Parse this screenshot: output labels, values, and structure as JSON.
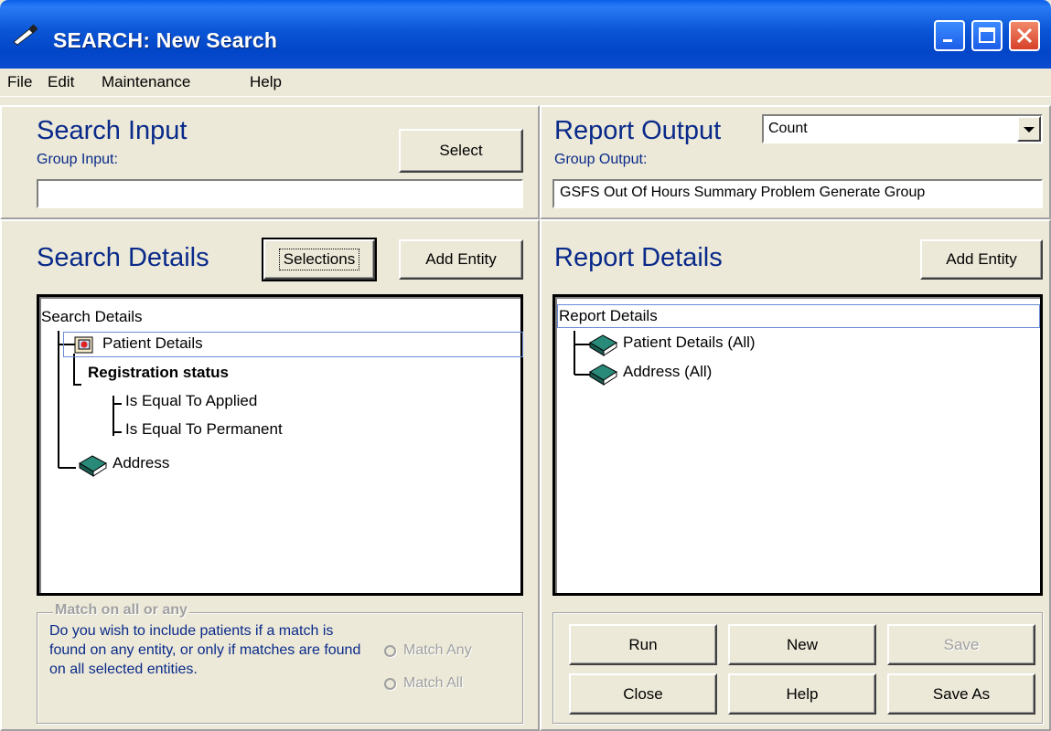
{
  "window": {
    "title": "SEARCH: New Search",
    "title_color": "#0a55d6"
  },
  "menu": {
    "file": "File",
    "edit": "Edit",
    "maintenance": "Maintenance",
    "help": "Help"
  },
  "search_input": {
    "heading": "Search Input",
    "group_label": "Group Input:",
    "group_value": "",
    "select_button": "Select"
  },
  "report_output": {
    "heading": "Report Output",
    "type_value": "Count",
    "group_label": "Group Output:",
    "group_value": "GSFS Out Of Hours Summary Problem Generate Group"
  },
  "search_details": {
    "heading": "Search Details",
    "selections_button": "Selections",
    "add_entity_button": "Add Entity",
    "tree": {
      "root": "Search Details",
      "nodes": [
        {
          "label": "Patient Details",
          "icon": "patient-details-icon"
        },
        {
          "label": "Registration status"
        },
        {
          "label": "Is Equal To Applied"
        },
        {
          "label": "Is Equal To Permanent"
        },
        {
          "label": "Address",
          "icon": "book-icon"
        }
      ]
    }
  },
  "report_details": {
    "heading": "Report Details",
    "add_entity_button": "Add Entity",
    "tree": {
      "root": "Report Details",
      "nodes": [
        {
          "label": "Patient Details (All)",
          "icon": "book-icon"
        },
        {
          "label": "Address (All)",
          "icon": "book-icon"
        }
      ]
    }
  },
  "match": {
    "title": "Match on all or any",
    "description": "Do you wish to include patients if a match is found on any entity, or only if matches are found on all selected entities.",
    "option_any": "Match Any",
    "option_all": "Match All"
  },
  "actions": {
    "run": "Run",
    "new": "New",
    "save": "Save",
    "close": "Close",
    "help": "Help",
    "save_as": "Save As"
  },
  "colors": {
    "heading_blue": "#0a2a8a",
    "background": "#ece9d8",
    "disabled_text": "#a0a0a0"
  }
}
